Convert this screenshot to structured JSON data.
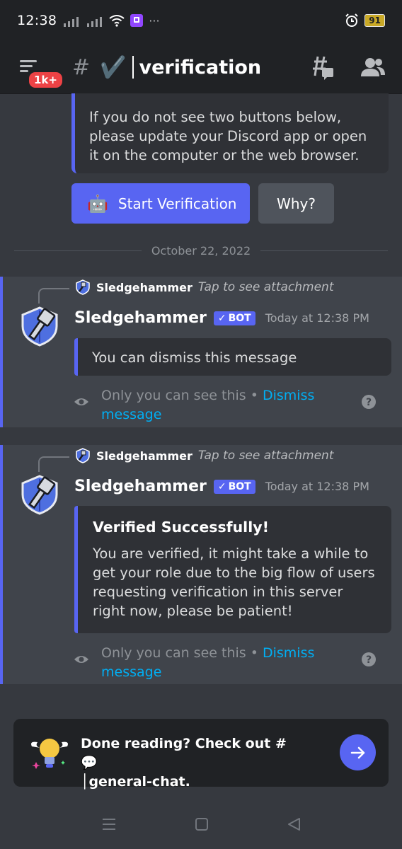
{
  "status_bar": {
    "time": "12:38",
    "battery": "91",
    "more": "···"
  },
  "header": {
    "badge": "1k+",
    "hash": "#",
    "channel_emoji": "✔️",
    "channel_name": "verification"
  },
  "top_embed": {
    "text": "If you do not see two buttons below, please update your Discord app or open it on the computer or the web browser."
  },
  "buttons": {
    "start_label": "Start Verification",
    "start_emoji": "🤖",
    "why_label": "Why?"
  },
  "divider": {
    "date": "October 22, 2022"
  },
  "messages": [
    {
      "reply_name": "Sledgehammer",
      "reply_tap": "Tap to see attachment",
      "author": "Sledgehammer",
      "bot_tag": "BOT",
      "timestamp": "Today at 12:38 PM",
      "embed_text": "You can dismiss this message",
      "only_you": "Only you can see this • ",
      "dismiss_link": "Dismiss message"
    },
    {
      "reply_name": "Sledgehammer",
      "reply_tap": "Tap to see attachment",
      "author": "Sledgehammer",
      "bot_tag": "BOT",
      "timestamp": "Today at 12:38 PM",
      "embed_title": "Verified Successfully!",
      "embed_text": "You are verified, it might take a while to get your role due to the big flow of users requesting verification in this server right now, please be patient!",
      "only_you": "Only you can see this • ",
      "dismiss_link": "Dismiss message"
    }
  ],
  "done_reading": {
    "text_line1": "Done reading? Check out #💬",
    "text_line2": "│general-chat."
  },
  "colors": {
    "blurple": "#5865f2",
    "background": "#36393f",
    "dark": "#202225",
    "link": "#00aff4",
    "red": "#ed4245"
  }
}
